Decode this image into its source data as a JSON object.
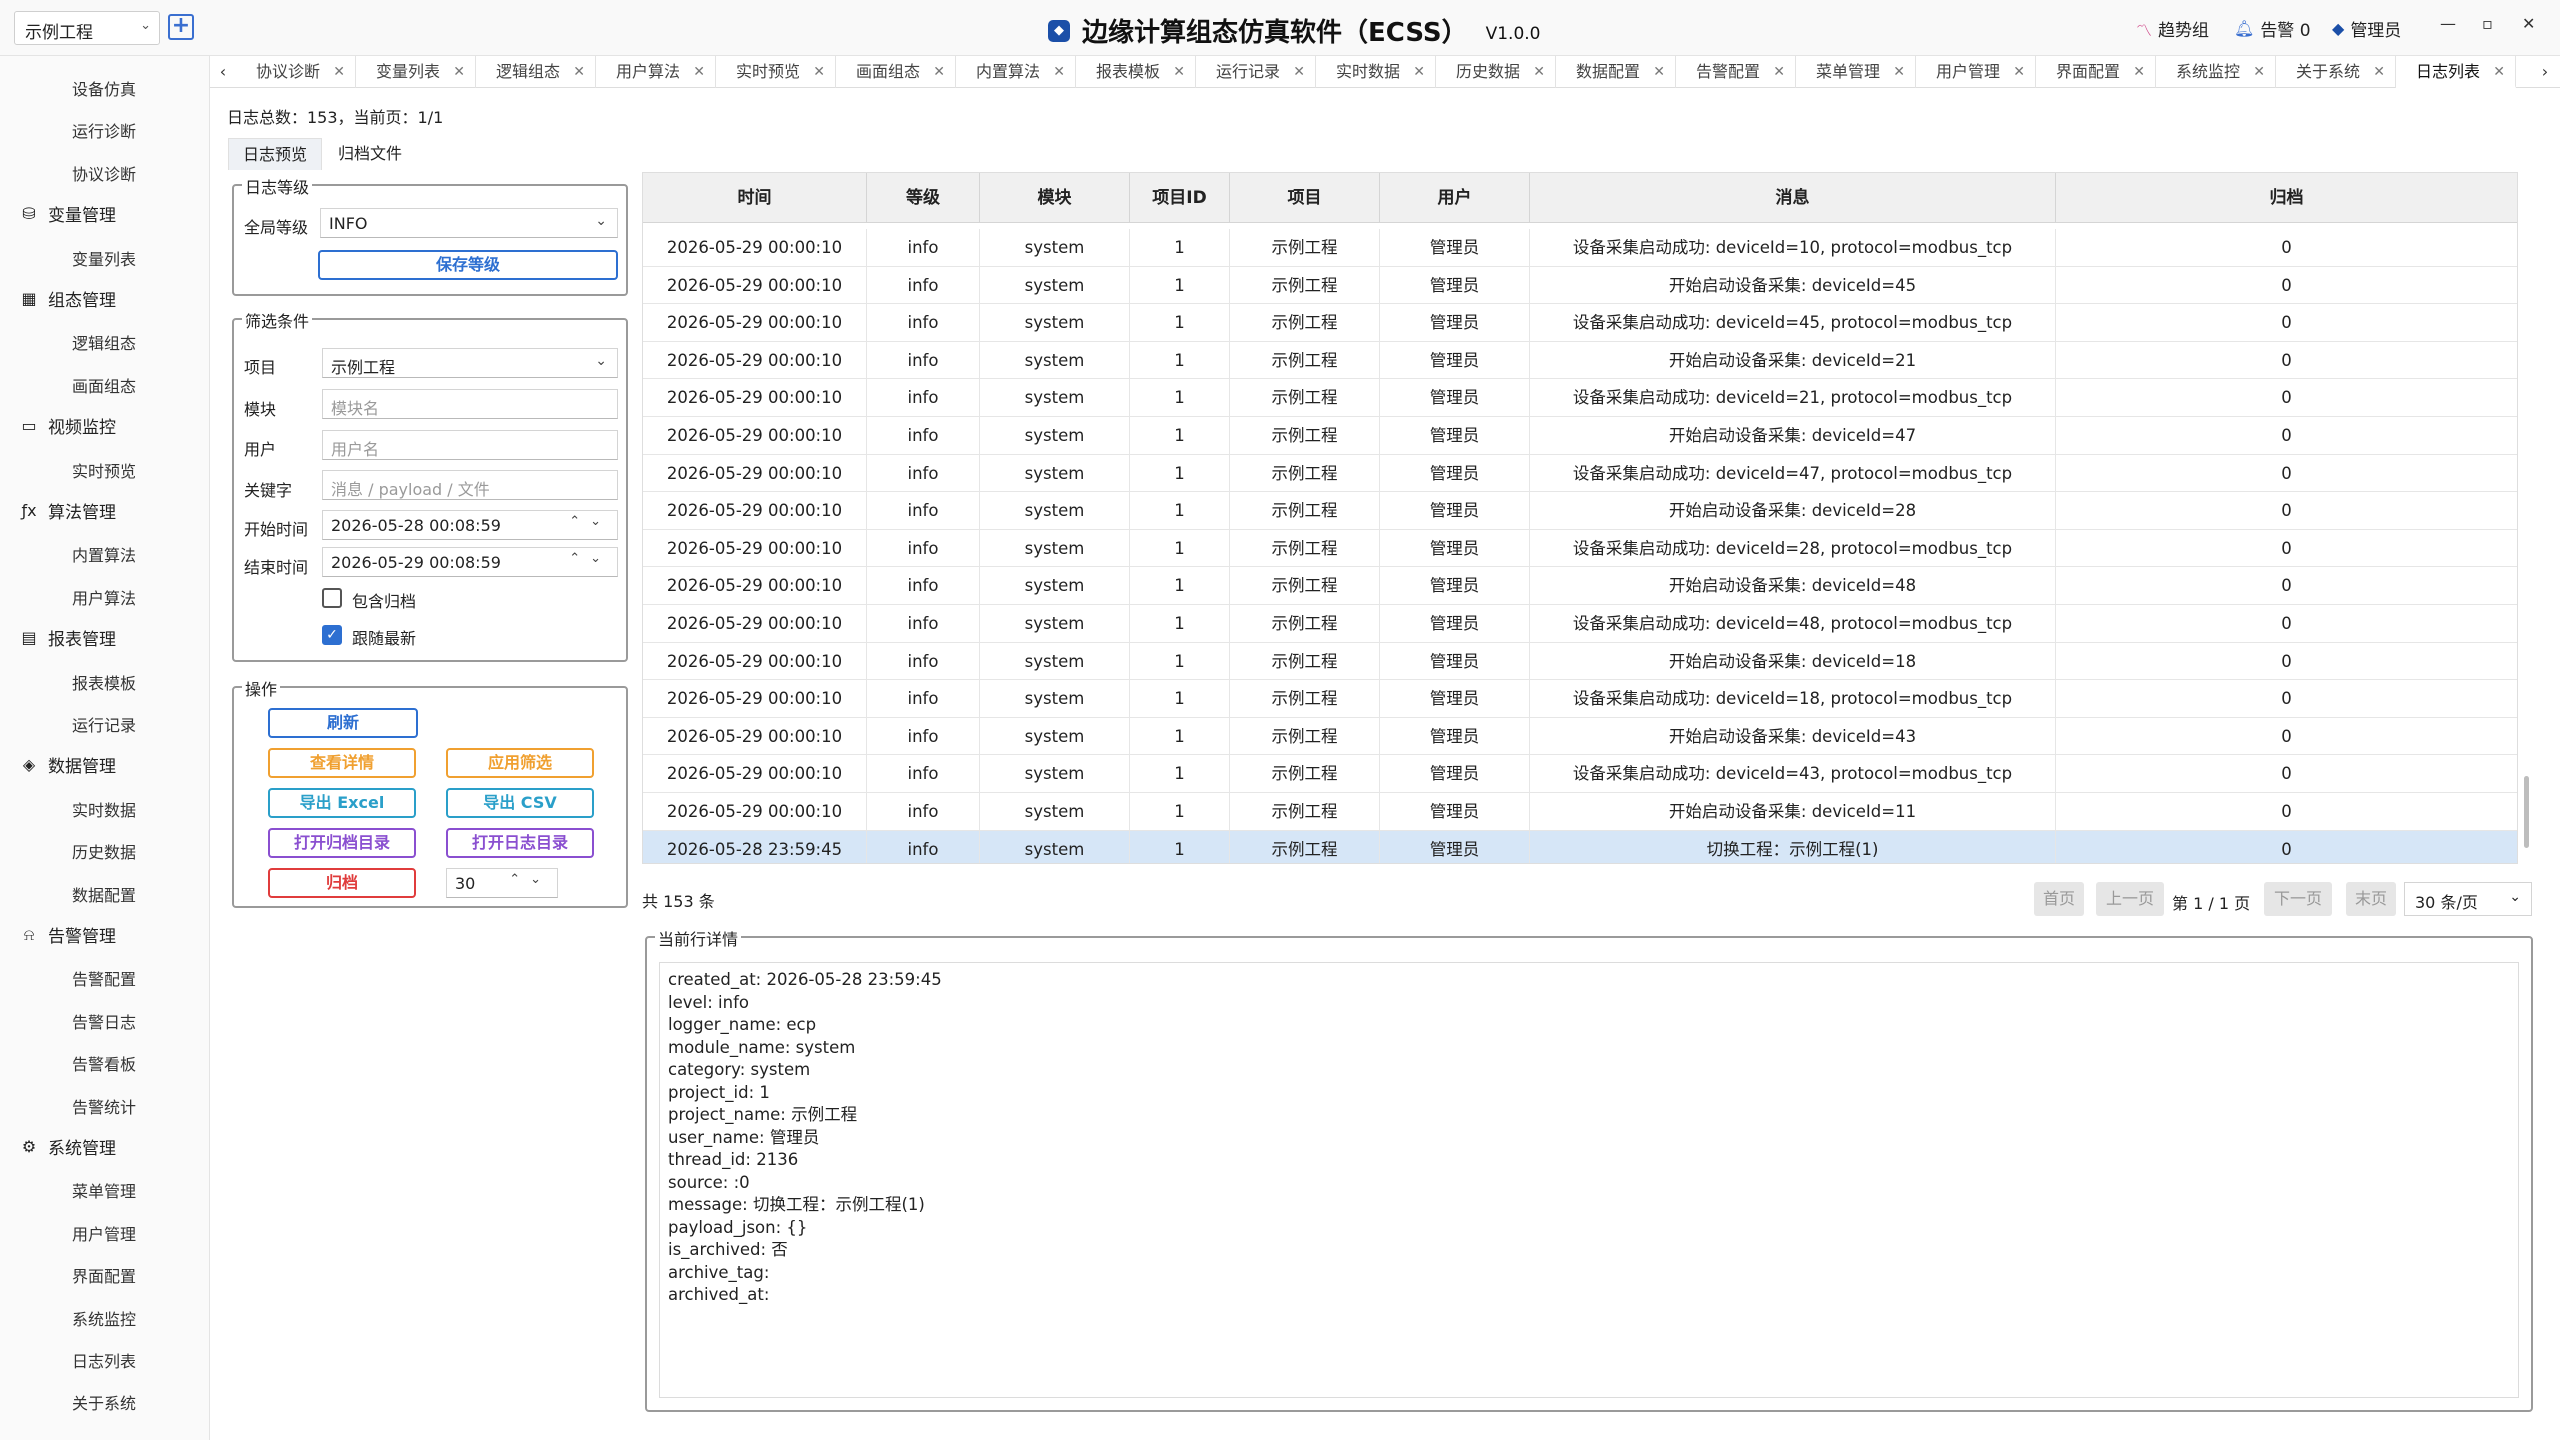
{
  "titlebar": {
    "project_select": "示例工程",
    "app_title": "边缘计算组态仿真软件（ECSS）",
    "version": "V1.0.0",
    "trend_group": "趋势组",
    "alarm": "告警 0",
    "user": "管理员"
  },
  "sidebar": {
    "items": [
      {
        "type": "item",
        "label": "设备仿真"
      },
      {
        "type": "item",
        "label": "运行诊断"
      },
      {
        "type": "item",
        "label": "协议诊断"
      },
      {
        "type": "group",
        "label": "变量管理",
        "icon": "database-icon"
      },
      {
        "type": "item",
        "label": "变量列表"
      },
      {
        "type": "group",
        "label": "组态管理",
        "icon": "grid-icon"
      },
      {
        "type": "item",
        "label": "逻辑组态"
      },
      {
        "type": "item",
        "label": "画面组态"
      },
      {
        "type": "group",
        "label": "视频监控",
        "icon": "folder-icon"
      },
      {
        "type": "item",
        "label": "实时预览"
      },
      {
        "type": "group",
        "label": "算法管理",
        "icon": "function-icon"
      },
      {
        "type": "item",
        "label": "内置算法"
      },
      {
        "type": "item",
        "label": "用户算法"
      },
      {
        "type": "group",
        "label": "报表管理",
        "icon": "report-icon"
      },
      {
        "type": "item",
        "label": "报表模板"
      },
      {
        "type": "item",
        "label": "运行记录"
      },
      {
        "type": "group",
        "label": "数据管理",
        "icon": "layers-icon"
      },
      {
        "type": "item",
        "label": "实时数据"
      },
      {
        "type": "item",
        "label": "历史数据"
      },
      {
        "type": "item",
        "label": "数据配置"
      },
      {
        "type": "group",
        "label": "告警管理",
        "icon": "bell-icon"
      },
      {
        "type": "item",
        "label": "告警配置"
      },
      {
        "type": "item",
        "label": "告警日志"
      },
      {
        "type": "item",
        "label": "告警看板"
      },
      {
        "type": "item",
        "label": "告警统计"
      },
      {
        "type": "group",
        "label": "系统管理",
        "icon": "gear-icon"
      },
      {
        "type": "item",
        "label": "菜单管理"
      },
      {
        "type": "item",
        "label": "用户管理"
      },
      {
        "type": "item",
        "label": "界面配置"
      },
      {
        "type": "item",
        "label": "系统监控"
      },
      {
        "type": "item",
        "label": "日志列表"
      },
      {
        "type": "item",
        "label": "关于系统"
      }
    ]
  },
  "tabs": [
    "协议诊断",
    "变量列表",
    "逻辑组态",
    "用户算法",
    "实时预览",
    "画面组态",
    "内置算法",
    "报表模板",
    "运行记录",
    "实时数据",
    "历史数据",
    "数据配置",
    "告警配置",
    "菜单管理",
    "用户管理",
    "界面配置",
    "系统监控",
    "关于系统",
    "日志列表"
  ],
  "active_tab": "日志列表",
  "summary": "日志总数：153，当前页：1/1",
  "subtabs": [
    "日志预览",
    "归档文件"
  ],
  "level_group": {
    "title": "日志等级",
    "label": "全局等级",
    "value": "INFO",
    "save": "保存等级"
  },
  "filter_group": {
    "title": "筛选条件",
    "project_label": "项目",
    "project_value": "示例工程",
    "module_label": "模块",
    "module_placeholder": "模块名",
    "user_label": "用户",
    "user_placeholder": "用户名",
    "keyword_label": "关键字",
    "keyword_placeholder": "消息 / payload / 文件",
    "start_label": "开始时间",
    "start_value": "2026-05-28 00:08:59",
    "end_label": "结束时间",
    "end_value": "2026-05-29 00:08:59",
    "include_archived": "包含归档",
    "follow_latest": "跟随最新"
  },
  "ops_group": {
    "title": "操作",
    "refresh": "刷新",
    "view_detail": "查看详情",
    "apply_filter": "应用筛选",
    "export_excel": "导出 Excel",
    "export_csv": "导出 CSV",
    "open_archive_dir": "打开归档目录",
    "open_log_dir": "打开日志目录",
    "archive": "归档",
    "archive_days": "30"
  },
  "table": {
    "columns": [
      "时间",
      "等级",
      "模块",
      "项目ID",
      "项目",
      "用户",
      "消息",
      "归档"
    ],
    "rows": [
      [
        "2026-05-29 00:00:10",
        "info",
        "system",
        "1",
        "示例工程",
        "管理员",
        "设备采集启动成功: deviceId=10, protocol=modbus_tcp",
        "0"
      ],
      [
        "2026-05-29 00:00:10",
        "info",
        "system",
        "1",
        "示例工程",
        "管理员",
        "开始启动设备采集: deviceId=45",
        "0"
      ],
      [
        "2026-05-29 00:00:10",
        "info",
        "system",
        "1",
        "示例工程",
        "管理员",
        "设备采集启动成功: deviceId=45, protocol=modbus_tcp",
        "0"
      ],
      [
        "2026-05-29 00:00:10",
        "info",
        "system",
        "1",
        "示例工程",
        "管理员",
        "开始启动设备采集: deviceId=21",
        "0"
      ],
      [
        "2026-05-29 00:00:10",
        "info",
        "system",
        "1",
        "示例工程",
        "管理员",
        "设备采集启动成功: deviceId=21, protocol=modbus_tcp",
        "0"
      ],
      [
        "2026-05-29 00:00:10",
        "info",
        "system",
        "1",
        "示例工程",
        "管理员",
        "开始启动设备采集: deviceId=47",
        "0"
      ],
      [
        "2026-05-29 00:00:10",
        "info",
        "system",
        "1",
        "示例工程",
        "管理员",
        "设备采集启动成功: deviceId=47, protocol=modbus_tcp",
        "0"
      ],
      [
        "2026-05-29 00:00:10",
        "info",
        "system",
        "1",
        "示例工程",
        "管理员",
        "开始启动设备采集: deviceId=28",
        "0"
      ],
      [
        "2026-05-29 00:00:10",
        "info",
        "system",
        "1",
        "示例工程",
        "管理员",
        "设备采集启动成功: deviceId=28, protocol=modbus_tcp",
        "0"
      ],
      [
        "2026-05-29 00:00:10",
        "info",
        "system",
        "1",
        "示例工程",
        "管理员",
        "开始启动设备采集: deviceId=48",
        "0"
      ],
      [
        "2026-05-29 00:00:10",
        "info",
        "system",
        "1",
        "示例工程",
        "管理员",
        "设备采集启动成功: deviceId=48, protocol=modbus_tcp",
        "0"
      ],
      [
        "2026-05-29 00:00:10",
        "info",
        "system",
        "1",
        "示例工程",
        "管理员",
        "开始启动设备采集: deviceId=18",
        "0"
      ],
      [
        "2026-05-29 00:00:10",
        "info",
        "system",
        "1",
        "示例工程",
        "管理员",
        "设备采集启动成功: deviceId=18, protocol=modbus_tcp",
        "0"
      ],
      [
        "2026-05-29 00:00:10",
        "info",
        "system",
        "1",
        "示例工程",
        "管理员",
        "开始启动设备采集: deviceId=43",
        "0"
      ],
      [
        "2026-05-29 00:00:10",
        "info",
        "system",
        "1",
        "示例工程",
        "管理员",
        "设备采集启动成功: deviceId=43, protocol=modbus_tcp",
        "0"
      ],
      [
        "2026-05-29 00:00:10",
        "info",
        "system",
        "1",
        "示例工程",
        "管理员",
        "开始启动设备采集: deviceId=11",
        "0"
      ],
      [
        "2026-05-28 23:59:45",
        "info",
        "system",
        "1",
        "示例工程",
        "管理员",
        "切换工程：示例工程(1)",
        "0"
      ]
    ]
  },
  "pager": {
    "total": "共 153 条",
    "first": "首页",
    "prev": "上一页",
    "info": "第 1 / 1 页",
    "next": "下一页",
    "last": "末页",
    "page_size": "30 条/页"
  },
  "detail": {
    "title": "当前行详情",
    "text": "created_at: 2026-05-28 23:59:45\nlevel: info\nlogger_name: ecp\nmodule_name: system\ncategory: system\nproject_id: 1\nproject_name: 示例工程\nuser_name: 管理员\nthread_id: 2136\nsource: :0\nmessage: 切换工程：示例工程(1)\npayload_json: {}\nis_archived: 否\narchive_tag:\narchived_at:"
  },
  "colors": {
    "accent": "#2d6fd1",
    "orange": "#f0a030",
    "teal": "#2a9fc9",
    "purple": "#8a4fd0",
    "red": "#e03c3c",
    "selected_row": "#d6e6f7"
  }
}
